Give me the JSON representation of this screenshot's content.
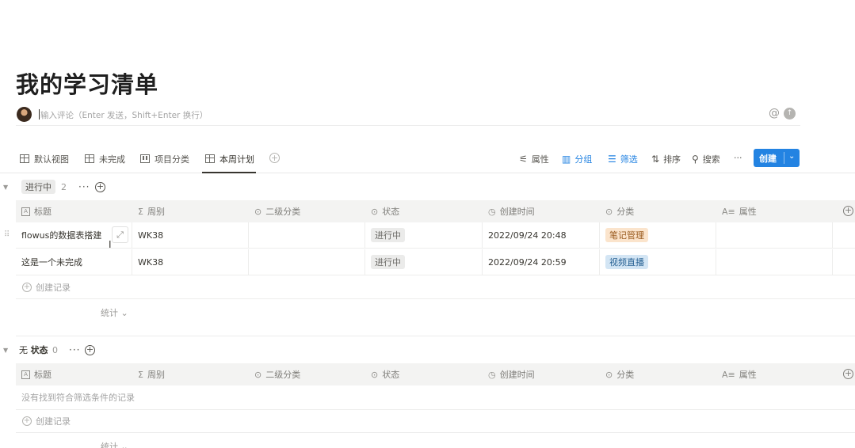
{
  "page": {
    "title": "我的学习清单"
  },
  "comment": {
    "placeholder": "输入评论（Enter 发送，Shift+Enter 换行）",
    "at_icon": "@",
    "send_icon": "arrow-up-icon"
  },
  "views": {
    "tabs": [
      {
        "label": "默认视图",
        "icon": "table-icon",
        "active": false
      },
      {
        "label": "未完成",
        "icon": "table-icon",
        "active": false
      },
      {
        "label": "项目分类",
        "icon": "board-icon",
        "active": false
      },
      {
        "label": "本周计划",
        "icon": "table-icon",
        "active": true
      }
    ],
    "add_icon": "+"
  },
  "toolbar": {
    "properties": "属性",
    "group": "分组",
    "filter": "筛选",
    "sort": "排序",
    "search": "搜索",
    "more": "···",
    "create": "创建",
    "accent": "#2383e2"
  },
  "columns": [
    {
      "label": "标题",
      "icon": "A"
    },
    {
      "label": "周别",
      "icon": "Σ"
    },
    {
      "label": "二级分类",
      "icon": "⊙"
    },
    {
      "label": "状态",
      "icon": "⊙"
    },
    {
      "label": "创建时间",
      "icon": "◷"
    },
    {
      "label": "分类",
      "icon": "⊙"
    },
    {
      "label": "属性",
      "icon": "A≡"
    }
  ],
  "groups": [
    {
      "label": "进行中",
      "count": "2",
      "dots": "···",
      "rows": [
        {
          "title": "flowus的数据表搭建",
          "week": "WK38",
          "sub": "",
          "status": "进行中",
          "created": "2022/09/24 20:48",
          "category": "笔记管理",
          "category_color": "orange"
        },
        {
          "title": "这是一个未完成",
          "week": "WK38",
          "sub": "",
          "status": "进行中",
          "created": "2022/09/24 20:59",
          "category": "视频直播",
          "category_color": "blue"
        }
      ],
      "add_label": "创建记录",
      "stat_label": "统计 ⌄"
    },
    {
      "label_prefix": "无",
      "label": "状态",
      "count": "0",
      "dots": "···",
      "empty_label": "没有找到符合筛选条件的记录",
      "add_label": "创建记录",
      "stat_label": "统计 ⌄"
    }
  ]
}
